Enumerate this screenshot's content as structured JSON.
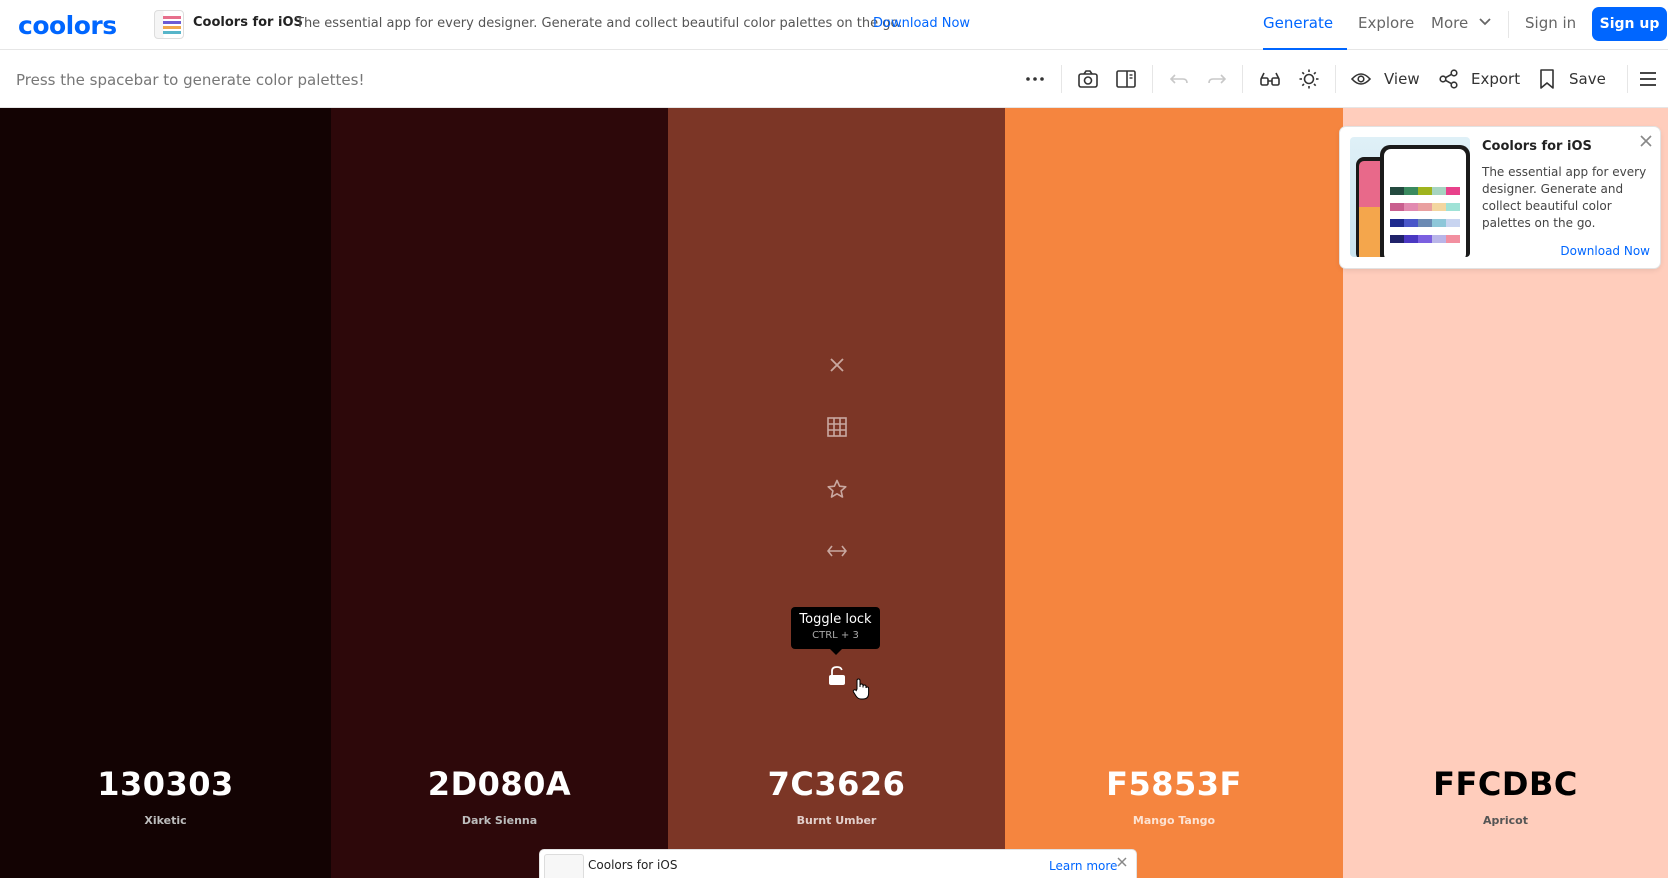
{
  "nav": {
    "logo": "coolors",
    "promo_title": "Coolors for iOS",
    "promo_text": "The essential app for every designer. Generate and collect beautiful color palettes on the go.",
    "promo_link": "Download Now",
    "generate": "Generate",
    "explore": "Explore",
    "more": "More",
    "signin": "Sign in",
    "signup": "Sign up",
    "accent": "#0066ff"
  },
  "toolbar": {
    "hint": "Press the spacebar to generate color palettes!",
    "view": "View",
    "export": "Export",
    "save": "Save",
    "icons": [
      "more-dots-icon",
      "camera-icon",
      "sidebar-panel-icon",
      "undo-icon",
      "redo-icon",
      "glasses-icon",
      "sun-icon",
      "eye-icon",
      "share-icon",
      "bookmark-icon",
      "hamburger-menu-icon"
    ]
  },
  "palette": [
    {
      "hex": "130303",
      "name": "Xiketic",
      "bg": "#130303",
      "fg": "#ffffff",
      "sub": "#bdbdbd"
    },
    {
      "hex": "2D080A",
      "name": "Dark Sienna",
      "bg": "#2d080a",
      "fg": "#ffffff",
      "sub": "#bdbdbd"
    },
    {
      "hex": "7C3626",
      "name": "Burnt Umber",
      "bg": "#7c3626",
      "fg": "#ffffff",
      "sub": "#e2cfcb"
    },
    {
      "hex": "F5853F",
      "name": "Mango Tango",
      "bg": "#f5853f",
      "fg": "#ffffff",
      "sub": "#fde3d3"
    },
    {
      "hex": "FFCDBC",
      "name": "Apricot",
      "bg": "#ffcdbc",
      "fg": "#000000",
      "sub": "#555555"
    }
  ],
  "tooltip": {
    "title": "Toggle lock",
    "shortcut": "CTRL + 3"
  },
  "card": {
    "title": "Coolors for iOS",
    "text": "The essential app for every designer. Generate and collect beautiful color palettes on the go.",
    "link": "Download Now"
  },
  "bottom_promo": {
    "title": "Coolors for iOS",
    "link": "Learn more"
  }
}
